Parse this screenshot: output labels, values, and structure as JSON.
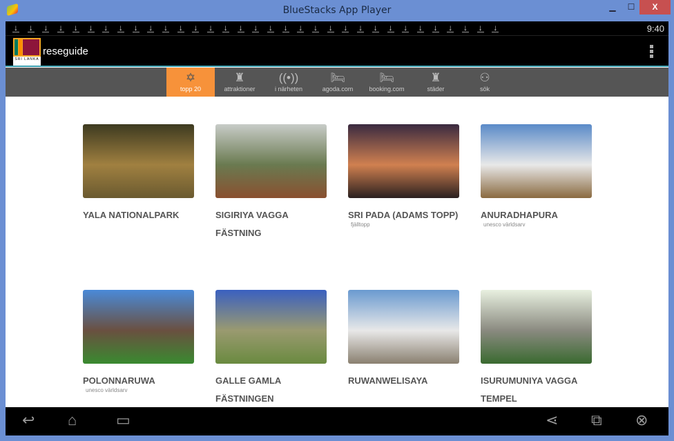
{
  "window": {
    "title": "BlueStacks App Player",
    "minimize": "▁",
    "maximize": "☐",
    "close": "X"
  },
  "status": {
    "clock": "9:40",
    "download_count": 33
  },
  "app": {
    "name": "reseguide",
    "flag_text": "SRI LANKA"
  },
  "tabs": [
    {
      "label": "topp 20",
      "icon": "star-of-david-icon",
      "glyph": "✡",
      "active": true
    },
    {
      "label": "attraktioner",
      "icon": "tower-icon",
      "glyph": "♜"
    },
    {
      "label": "i närheten",
      "icon": "radar-icon",
      "glyph": "((•))"
    },
    {
      "label": "agoda.com",
      "icon": "bed-icon",
      "glyph": "🛏"
    },
    {
      "label": "booking.com",
      "icon": "bed-icon",
      "glyph": "🛏"
    },
    {
      "label": "städer",
      "icon": "tower-icon",
      "glyph": "♜"
    },
    {
      "label": "sök",
      "icon": "binoculars-icon",
      "glyph": "⚇"
    }
  ],
  "places": [
    {
      "title": "YALA NATIONALPARK",
      "subtitle": "",
      "colors": [
        "#3d3a20",
        "#a08040",
        "#6a5a30"
      ]
    },
    {
      "title": "SIGIRIYA VAGGA FÄSTNING",
      "subtitle": "",
      "colors": [
        "#c8ccc8",
        "#6a7a50",
        "#8a5030"
      ]
    },
    {
      "title": "SRI PADA (ADAMS TOPP)",
      "subtitle": "fjälltopp",
      "colors": [
        "#3a2a40",
        "#d08050",
        "#2a2020"
      ]
    },
    {
      "title": "ANURADHAPURA",
      "subtitle": "unesco världsarv",
      "colors": [
        "#5a8ac8",
        "#e8e8e8",
        "#8a6a40"
      ]
    },
    {
      "title": "POLONNARUWA",
      "subtitle": "unesco världsarv",
      "colors": [
        "#4a8ad8",
        "#6a5040",
        "#3a8a30"
      ]
    },
    {
      "title": "GALLE GAMLA FÄSTNINGEN",
      "subtitle": "",
      "colors": [
        "#3a60c0",
        "#9a9a70",
        "#6a8a40"
      ]
    },
    {
      "title": "RUWANWELISAYA",
      "subtitle": "",
      "colors": [
        "#6a9ad0",
        "#e8e8e8",
        "#8a8070"
      ]
    },
    {
      "title": "ISURUMUNIYA VAGGA TEMPEL",
      "subtitle": "",
      "colors": [
        "#e8f0e0",
        "#8a8a80",
        "#3a6a30"
      ]
    }
  ],
  "navbar": {
    "back": "↩",
    "home": "⌂",
    "recents": "▭",
    "share": "⋖",
    "screen": "⧉",
    "close": "⊗"
  }
}
